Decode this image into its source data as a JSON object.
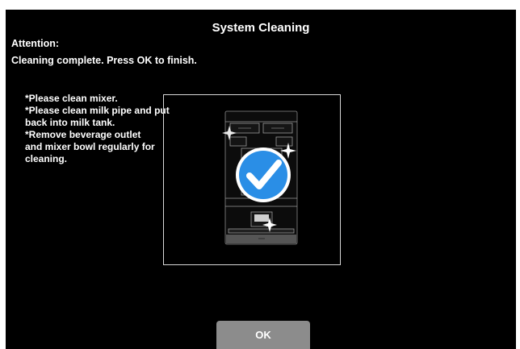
{
  "header": {
    "title": "System Cleaning"
  },
  "message": {
    "heading": "Attention:",
    "text": "Cleaning complete. Press OK to finish."
  },
  "instructions": {
    "lines": [
      "*Please clean mixer.",
      "*Please clean milk pipe and put",
      "back into milk tank.",
      "*Remove beverage outlet",
      "and mixer bowl regularly for",
      "cleaning."
    ]
  },
  "illustration": {
    "icon": "checkmark-circle-icon",
    "accent_color": "#2a8ee6",
    "frame_color": "#d8d8d8"
  },
  "footer": {
    "ok_label": "OK",
    "button_color": "#8c8c8c"
  }
}
